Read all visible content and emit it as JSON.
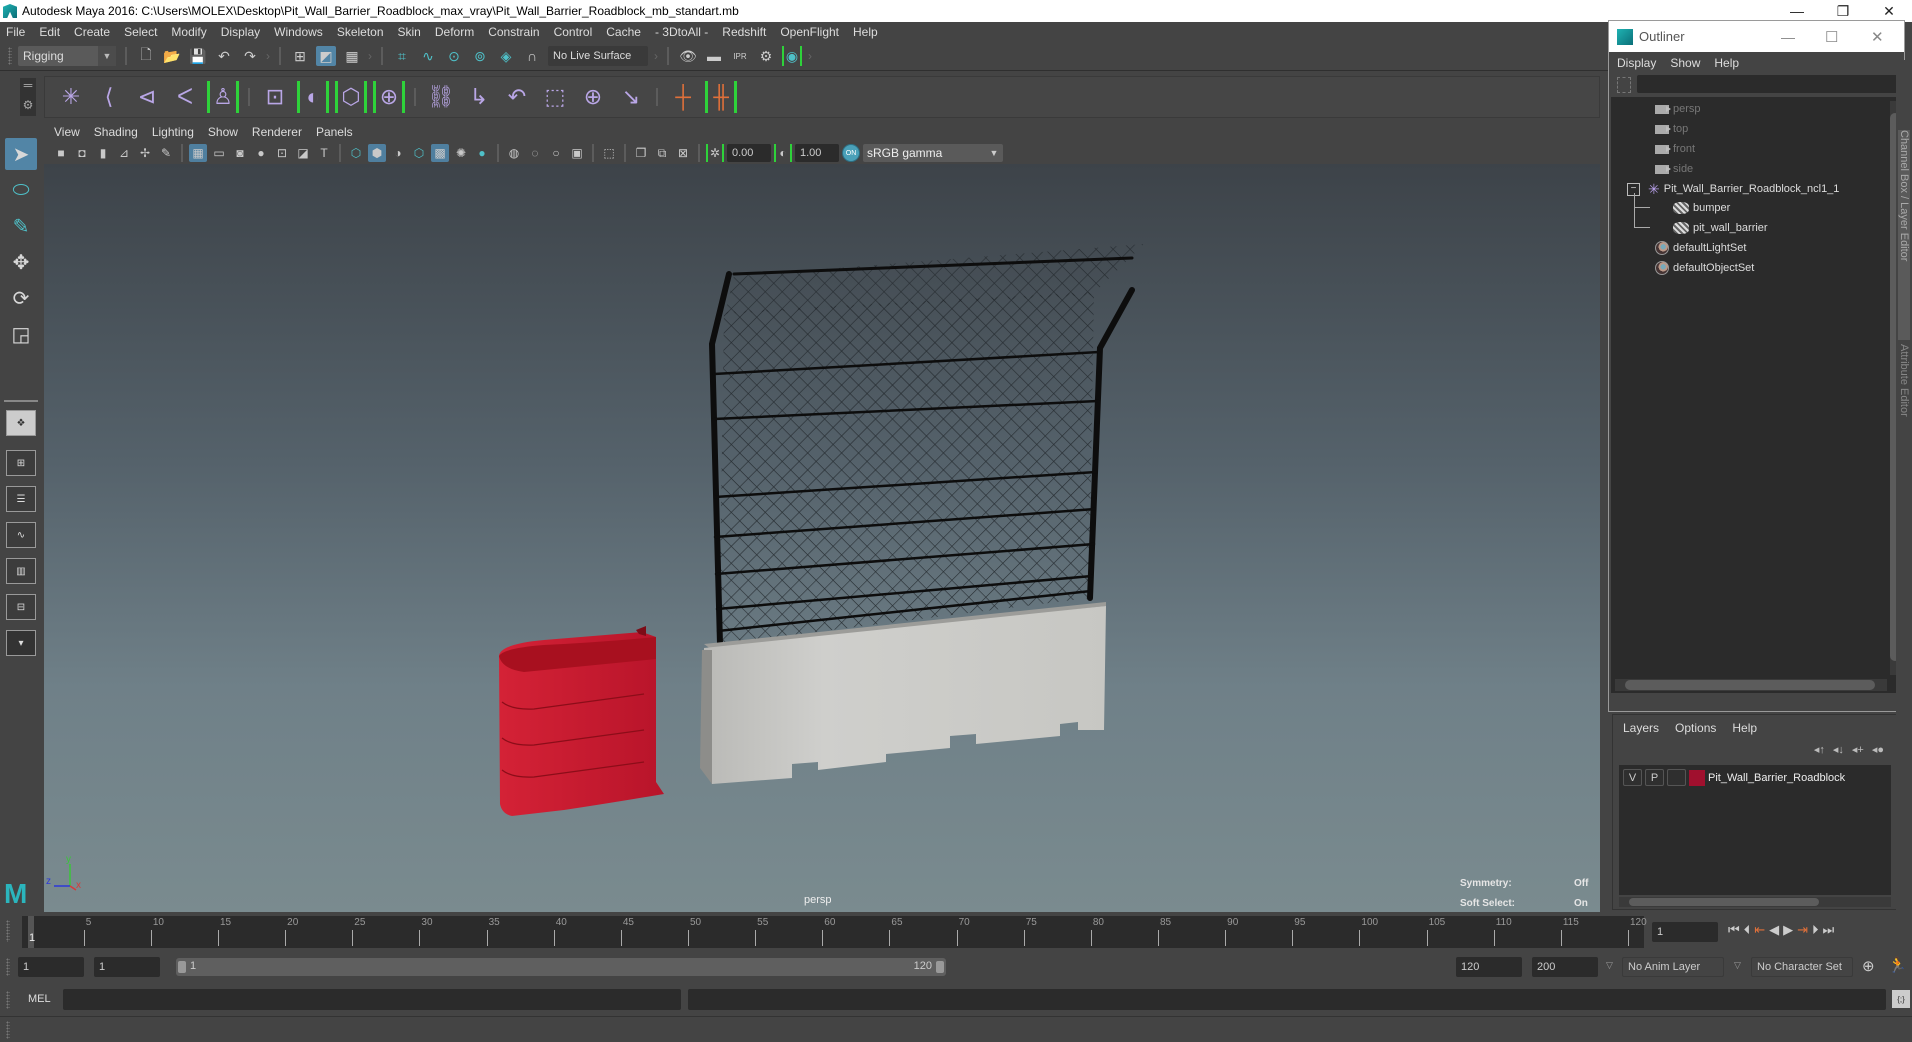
{
  "window": {
    "title": "Autodesk Maya 2016: C:\\Users\\MOLEX\\Desktop\\Pit_Wall_Barrier_Roadblock_max_vray\\Pit_Wall_Barrier_Roadblock_mb_standart.mb",
    "controls": {
      "minimize": "—",
      "restore": "❐",
      "close": "✕"
    }
  },
  "menubar": [
    "File",
    "Edit",
    "Create",
    "Select",
    "Modify",
    "Display",
    "Windows",
    "Skeleton",
    "Skin",
    "Deform",
    "Constrain",
    "Control",
    "Cache",
    "- 3DtoAll -",
    "Redshift",
    "OpenFlight",
    "Help"
  ],
  "statusline": {
    "menuset": "Rigging",
    "live_surface": "No Live Surface",
    "icons": [
      "new-scene-icon",
      "open-scene-icon",
      "save-scene-icon",
      "undo-icon",
      "redo-icon",
      "select-hierarchy-icon",
      "select-object-icon",
      "select-component-icon",
      "snap-grid-icon",
      "snap-curve-icon",
      "snap-point-icon",
      "snap-projected-icon",
      "snap-view-icon",
      "make-live-icon",
      "render-view-icon",
      "render-frame-icon",
      "ipr-render-icon",
      "render-settings-icon",
      "hypershade-icon"
    ]
  },
  "shelf": {
    "icons": [
      "joint-tool",
      "ik-handle",
      "ik-spline-handle",
      "mirror-joint",
      "humanik-character",
      "paint-skin-weights",
      "bind-skin",
      "smooth-bind",
      "lattice",
      "cluster",
      "point-constraint",
      "aim-constraint",
      "orient-constraint",
      "scale-constraint",
      "parent-constraint",
      "pole-vector-constraint",
      "add-influence",
      "remove-influence"
    ]
  },
  "toolbox": [
    "select-tool",
    "lasso-tool",
    "paint-select-tool",
    "move-tool",
    "rotate-tool",
    "scale-tool"
  ],
  "panel": {
    "menu": [
      "View",
      "Shading",
      "Lighting",
      "Show",
      "Renderer",
      "Panels"
    ],
    "exposure": "0.00",
    "gamma": "1.00",
    "color_management": "ON",
    "view_transform": "sRGB gamma",
    "camera": "persp",
    "hud": {
      "symmetry_label": "Symmetry:",
      "symmetry_value": "Off",
      "soft_select_label": "Soft Select:",
      "soft_select_value": "On"
    },
    "axis": {
      "x": "x",
      "y": "y",
      "z": "z"
    }
  },
  "timeline": {
    "ticks": [
      5,
      10,
      15,
      20,
      25,
      30,
      35,
      40,
      45,
      50,
      55,
      60,
      65,
      70,
      75,
      80,
      85,
      90,
      95,
      100,
      105,
      110,
      115,
      120
    ],
    "start": 1,
    "end": 120,
    "current_frame_label": "1",
    "current_frame": "1"
  },
  "range": {
    "start": "1",
    "playback_start": "1",
    "slider_start": "1",
    "slider_end": "120",
    "playback_end": "120",
    "end": "200",
    "anim_layer": "No Anim Layer",
    "character_set": "No Character Set"
  },
  "cmdline": {
    "label": "MEL",
    "value": "",
    "result": ""
  },
  "outliner": {
    "title": "Outliner",
    "menu": [
      "Display",
      "Show",
      "Help"
    ],
    "search": "",
    "items": [
      {
        "label": "persp",
        "type": "camera",
        "dim": true
      },
      {
        "label": "top",
        "type": "camera",
        "dim": true
      },
      {
        "label": "front",
        "type": "camera",
        "dim": true
      },
      {
        "label": "side",
        "type": "camera",
        "dim": true
      },
      {
        "label": "Pit_Wall_Barrier_Roadblock_ncl1_1",
        "type": "group",
        "expanded": true
      },
      {
        "label": "bumper",
        "type": "mesh",
        "child": true
      },
      {
        "label": "pit_wall_barrier",
        "type": "mesh",
        "child": true
      },
      {
        "label": "defaultLightSet",
        "type": "set"
      },
      {
        "label": "defaultObjectSet",
        "type": "set"
      }
    ]
  },
  "layers": {
    "menu": [
      "Layers",
      "Options",
      "Help"
    ],
    "rows": [
      {
        "v": "V",
        "p": "P",
        "color": "#a0102e",
        "name": "Pit_Wall_Barrier_Roadblock"
      }
    ]
  },
  "side_tabs": [
    "Channel Box / Layer Editor",
    "Attribute Editor"
  ],
  "colors": {
    "accent": "#5285a6",
    "green_bracket": "#2ed23a",
    "bumper_red": "#c8172c",
    "concrete": "#c9c9c7"
  }
}
